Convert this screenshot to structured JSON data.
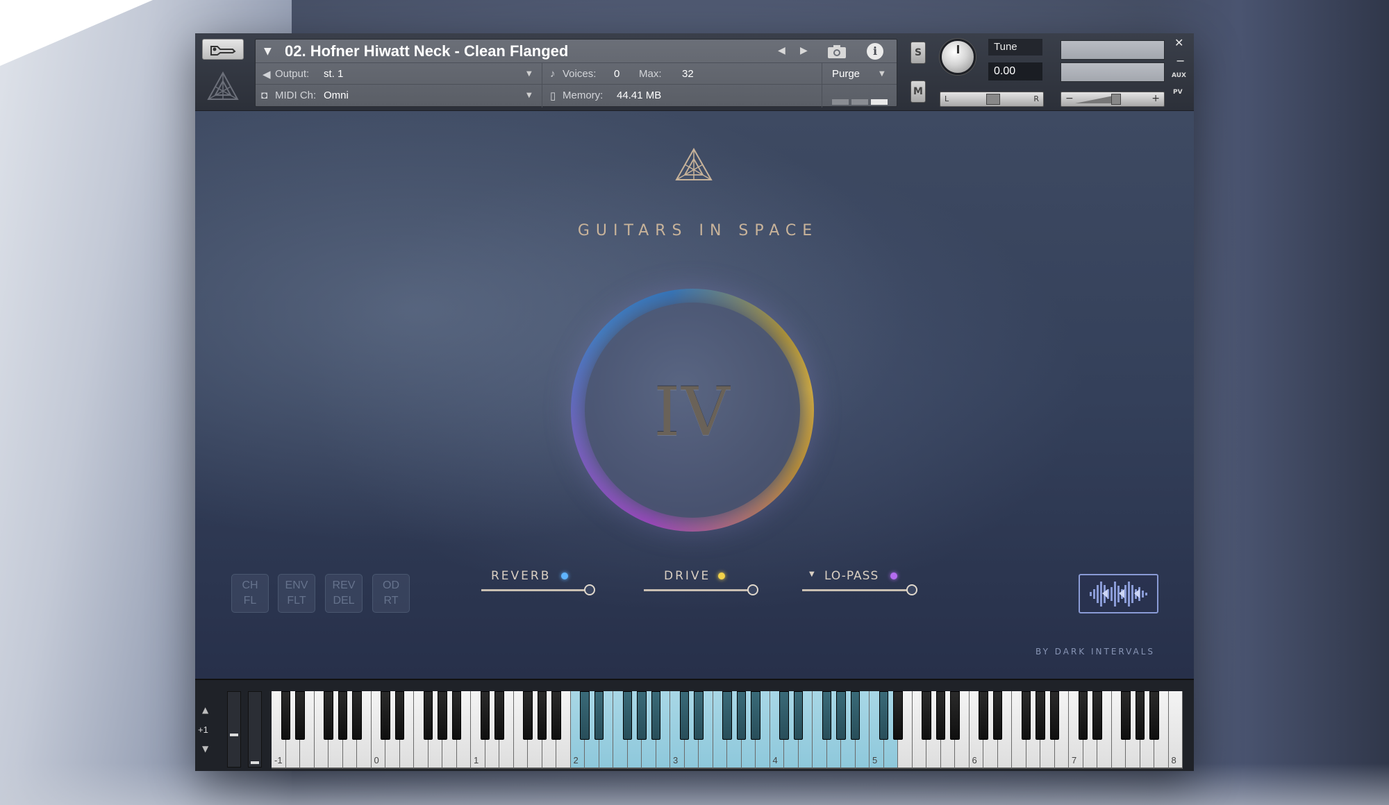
{
  "header": {
    "instrument_name": "02. Hofner Hiwatt Neck - Clean Flanged",
    "output_label": "Output:",
    "output_value": "st. 1",
    "voices_label": "Voices:",
    "voices_value": "0",
    "max_label": "Max:",
    "max_value": "32",
    "midi_label": "MIDI Ch:",
    "midi_value": "Omni",
    "memory_label": "Memory:",
    "memory_value": "44.41 MB",
    "purge_label": "Purge",
    "solo_label": "S",
    "mute_label": "M",
    "tune_label": "Tune",
    "tune_value": "0.00",
    "pan_left": "L",
    "pan_right": "R",
    "vol_minus": "−",
    "vol_plus": "+",
    "close_glyph": "✕",
    "minimize_glyph": "−",
    "aux_label": "AUX",
    "pv_label": "PV"
  },
  "main": {
    "brand_name": "GUITARS IN SPACE",
    "orb_numeral": "IV",
    "fx_buttons": [
      {
        "line1": "CH",
        "line2": "FL"
      },
      {
        "line1": "ENV",
        "line2": "FLT"
      },
      {
        "line1": "REV",
        "line2": "DEL"
      },
      {
        "line1": "OD",
        "line2": "RT"
      }
    ],
    "controls": [
      {
        "label": "REVERB",
        "dot_color": "#5fb4ff",
        "value": 1.0
      },
      {
        "label": "DRIVE",
        "dot_color": "#f2d24a",
        "value": 1.0
      },
      {
        "label": "LO-PASS",
        "dot_color": "#b46cf0",
        "value": 1.0
      }
    ],
    "by_label": "BY DARK INTERVALS"
  },
  "keyboard": {
    "octave_shift": "+1",
    "octave_labels": [
      "-1",
      "0",
      "1",
      "2",
      "3",
      "4",
      "5",
      "6",
      "7",
      "8"
    ],
    "range_start_octave": 2,
    "range_end_octave": 5
  }
}
